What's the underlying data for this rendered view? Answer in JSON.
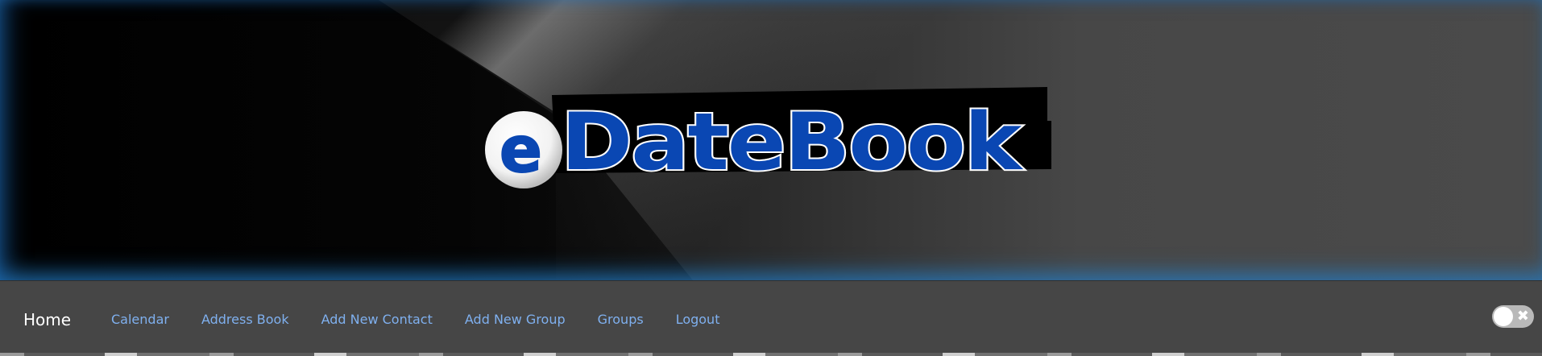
{
  "banner": {
    "logo_prefix": "e",
    "logo_text": "DateBook",
    "logo_colors": {
      "fill": "#0a47b3",
      "outline": "#ffffff",
      "shadow": "#000000",
      "bubble": "#ffffff"
    }
  },
  "navbar": {
    "brand": "Home",
    "links": [
      {
        "label": "Calendar"
      },
      {
        "label": "Address Book"
      },
      {
        "label": "Add New Contact"
      },
      {
        "label": "Add New Group"
      },
      {
        "label": "Groups"
      },
      {
        "label": "Logout"
      }
    ],
    "theme_toggle": {
      "icon": "close-icon",
      "state": "off"
    }
  },
  "colors": {
    "navbar_bg": "#464646",
    "link": "#7fb0ef",
    "brand": "#ffffff"
  }
}
